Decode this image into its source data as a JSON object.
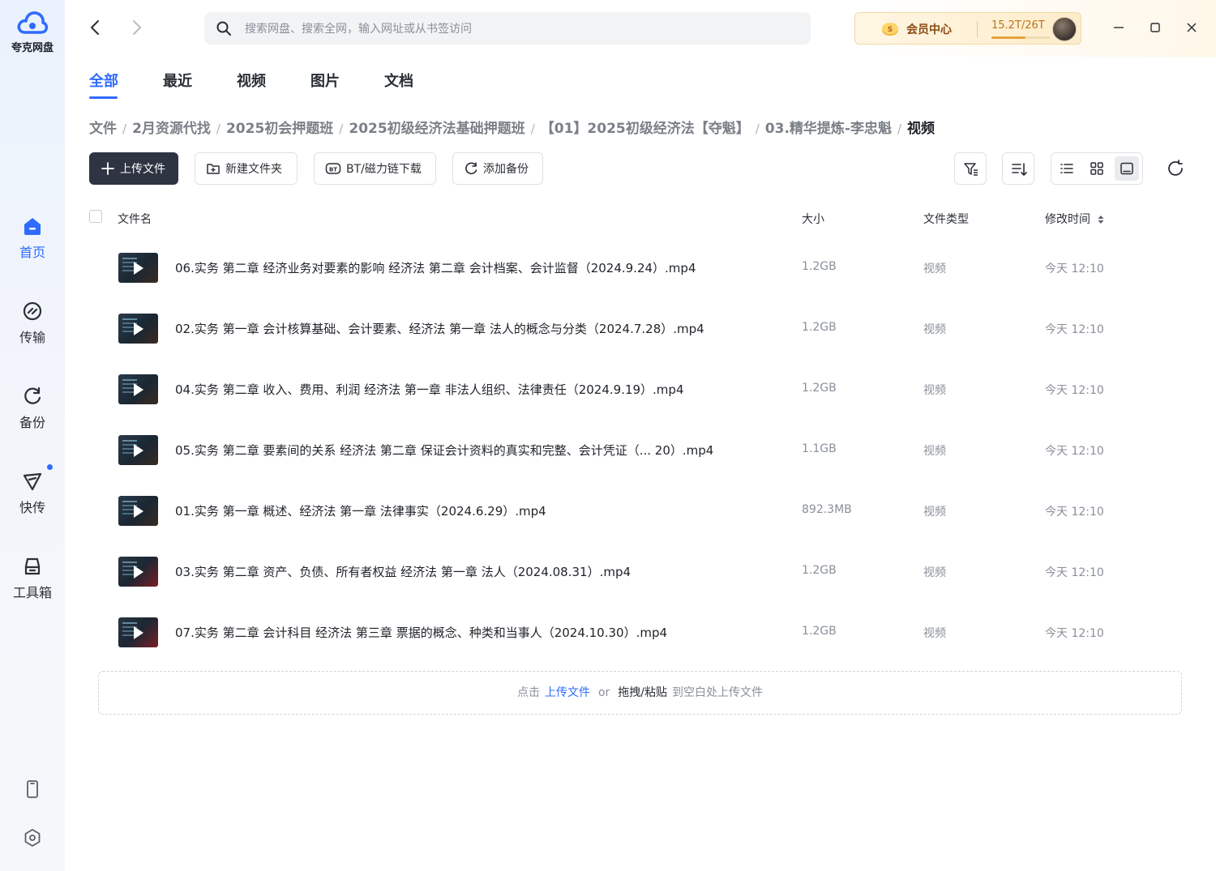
{
  "app": {
    "name": "夸克网盘",
    "brand_color": "#2f6bff"
  },
  "sidebar": {
    "items": [
      {
        "label": "首页",
        "icon": "home-icon",
        "active": true
      },
      {
        "label": "传输",
        "icon": "transfer-icon"
      },
      {
        "label": "备份",
        "icon": "backup-icon"
      },
      {
        "label": "快传",
        "icon": "quick-send-icon",
        "has_badge": true
      },
      {
        "label": "工具箱",
        "icon": "toolbox-icon"
      }
    ],
    "bottom": [
      {
        "icon": "phone-icon"
      },
      {
        "icon": "settings-icon"
      }
    ]
  },
  "topbar": {
    "search_placeholder": "搜索网盘、搜索全网，输入网址或从书签访问",
    "vip_label": "会员中心",
    "storage_text": "15.2T/26T",
    "storage_fraction": 0.585
  },
  "tabs": [
    "全部",
    "最近",
    "视频",
    "图片",
    "文档"
  ],
  "breadcrumb": [
    "文件",
    "2月资源代找",
    "2025初会押题班",
    "2025初级经济法基础押题班",
    "【01】2025初级经济法【夺魁】",
    "03.精华提炼-李忠魁",
    "视频"
  ],
  "toolbar": {
    "upload": "上传文件",
    "new_folder": "新建文件夹",
    "bt_download": "BT/磁力链下载",
    "add_backup": "添加备份"
  },
  "table": {
    "headers": {
      "name": "文件名",
      "size": "大小",
      "type": "文件类型",
      "modified": "修改时间"
    },
    "rows": [
      {
        "name": "06.实务 第二章   经济业务对要素的影响 经济法 第二章   会计档案、会计监督（2024.9.24）.mp4",
        "size": "1.2GB",
        "type": "视频",
        "modified": "今天 12:10"
      },
      {
        "name": "02.实务   第一章   会计核算基础、会计要素、经济法   第一章   法人的概念与分类（2024.7.28）.mp4",
        "size": "1.2GB",
        "type": "视频",
        "modified": "今天 12:10"
      },
      {
        "name": "04.实务   第二章   收入、费用、利润   经济法   第一章   非法人组织、法律责任（2024.9.19）.mp4",
        "size": "1.2GB",
        "type": "视频",
        "modified": "今天 12:10"
      },
      {
        "name": "05.实务   第二章   要素间的关系   经济法   第二章   保证会计资料的真实和完整、会计凭证（... 20）.mp4",
        "size": "1.1GB",
        "type": "视频",
        "modified": "今天 12:10"
      },
      {
        "name": "01.实务   第一章   概述、经济法   第一章   法律事实（2024.6.29）.mp4",
        "size": "892.3MB",
        "type": "视频",
        "modified": "今天 12:10"
      },
      {
        "name": "03.实务   第二章   资产、负债、所有者权益   经济法   第一章   法人（2024.08.31）.mp4",
        "size": "1.2GB",
        "type": "视频",
        "modified": "今天 12:10"
      },
      {
        "name": "07.实务 第二章 会计科目 经济法 第三章 票据的概念、种类和当事人（2024.10.30）.mp4",
        "size": "1.2GB",
        "type": "视频",
        "modified": "今天 12:10"
      }
    ]
  },
  "dropzone": {
    "prefix": "点击",
    "upload_link": "上传文件",
    "or": "or",
    "drag": "拖拽/粘贴",
    "suffix": "到空白处上传文件"
  }
}
